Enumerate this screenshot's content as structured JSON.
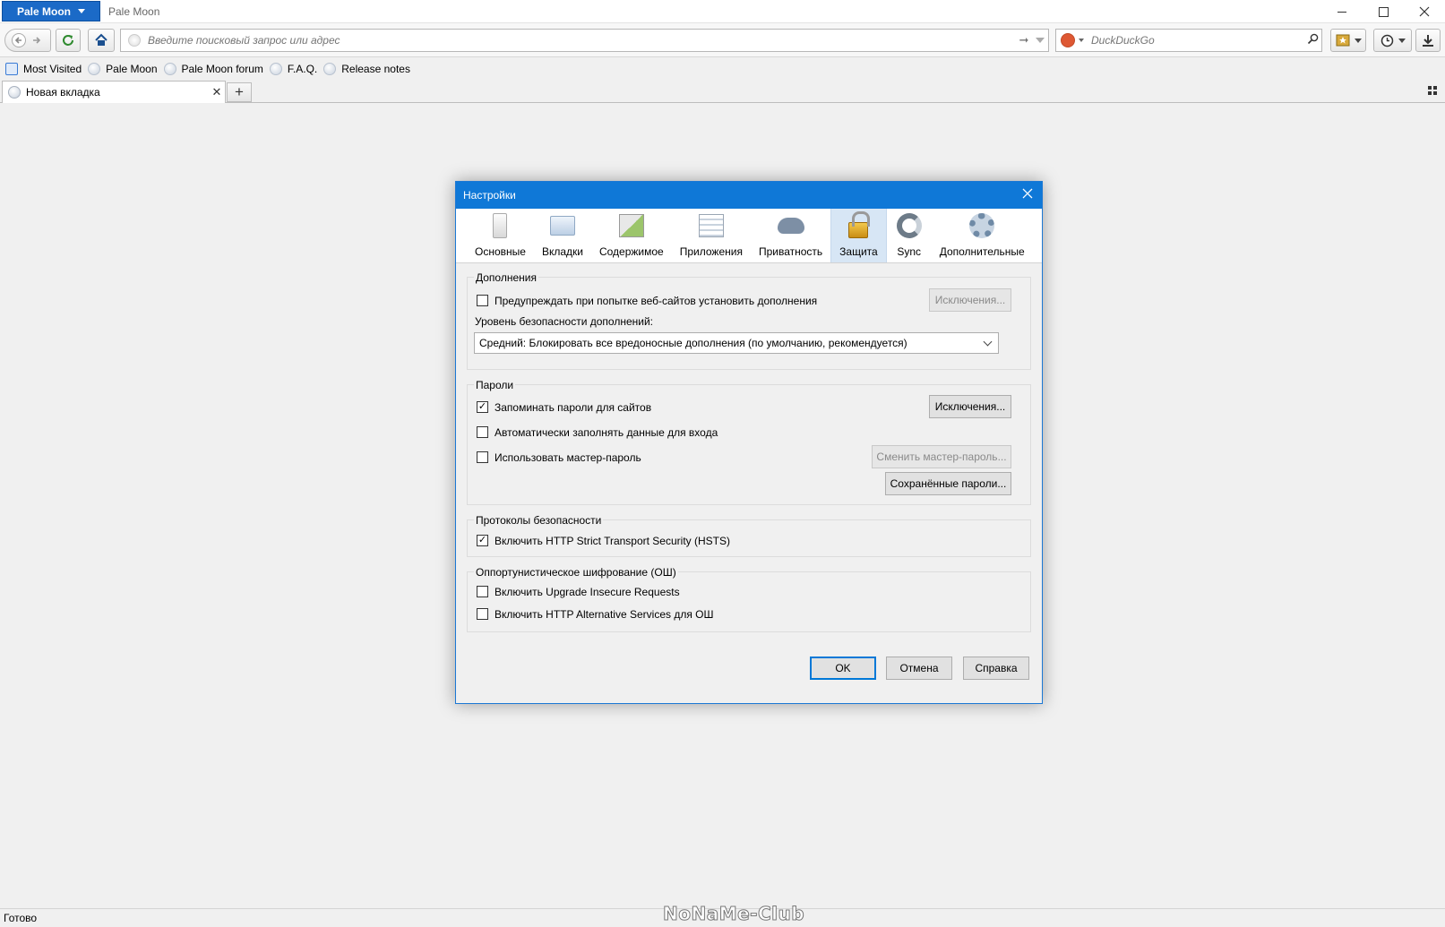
{
  "window": {
    "app_button": "Pale Moon",
    "title": "Pale Moon"
  },
  "navbar": {
    "url_placeholder": "Введите поисковый запрос или адрес",
    "search_placeholder": "DuckDuckGo"
  },
  "bookmarks": [
    {
      "label": "Most Visited"
    },
    {
      "label": "Pale Moon"
    },
    {
      "label": "Pale Moon forum"
    },
    {
      "label": "F.A.Q."
    },
    {
      "label": "Release notes"
    }
  ],
  "tab": {
    "label": "Новая вкладка"
  },
  "dialog": {
    "title": "Настройки",
    "tabs": [
      {
        "label": "Основные"
      },
      {
        "label": "Вкладки"
      },
      {
        "label": "Содержимое"
      },
      {
        "label": "Приложения"
      },
      {
        "label": "Приватность"
      },
      {
        "label": "Защита",
        "selected": true
      },
      {
        "label": "Sync"
      },
      {
        "label": "Дополнительные"
      }
    ],
    "addons": {
      "legend": "Дополнения",
      "warn_label": "Предупреждать при попытке веб-сайтов установить дополнения",
      "warn_checked": false,
      "exceptions_button": "Исключения...",
      "level_label": "Уровень безопасности дополнений:",
      "level_value": "Средний: Блокировать все вредоносные дополнения (по умолчанию, рекомендуется)"
    },
    "passwords": {
      "legend": "Пароли",
      "remember_label": "Запоминать пароли для сайтов",
      "remember_checked": true,
      "exceptions_button": "Исключения...",
      "autofill_label": "Автоматически заполнять данные для входа",
      "autofill_checked": false,
      "master_label": "Использовать мастер-пароль",
      "master_checked": false,
      "change_master_button": "Сменить мастер-пароль...",
      "saved_button": "Сохранённые пароли..."
    },
    "protocols": {
      "legend": "Протоколы безопасности",
      "hsts_label": "Включить HTTP Strict Transport Security (HSTS)",
      "hsts_checked": true
    },
    "opportunistic": {
      "legend": "Оппортунистическое шифрование (ОШ)",
      "upgrade_label": "Включить Upgrade Insecure Requests",
      "upgrade_checked": false,
      "altsvc_label": "Включить HTTP Alternative Services для ОШ",
      "altsvc_checked": false
    },
    "footer": {
      "ok": "OK",
      "cancel": "Отмена",
      "help": "Справка"
    }
  },
  "status": {
    "text": "Готово"
  },
  "watermark": "NoNaMe-Club",
  "colors": {
    "accent": "#0f78d7",
    "app_button": "#1b6ac7",
    "selected_tab": "#d7e6f5"
  }
}
